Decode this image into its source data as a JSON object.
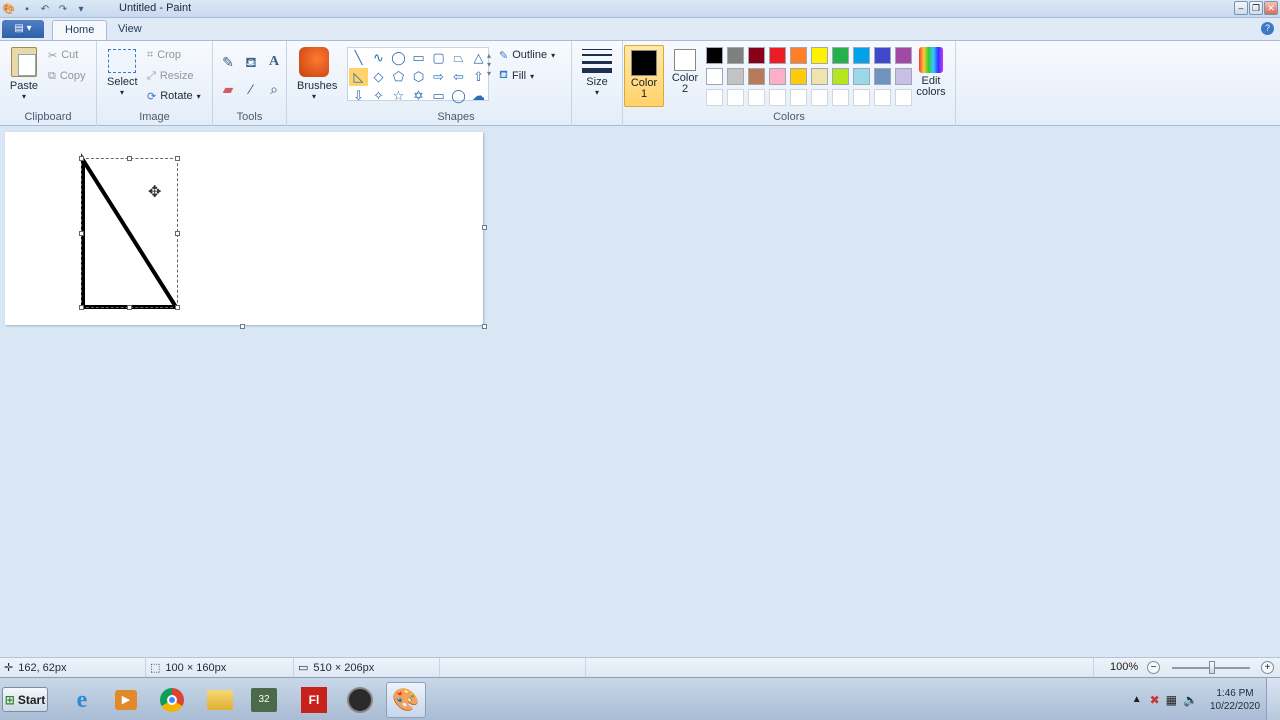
{
  "window": {
    "title": "Untitled - Paint"
  },
  "tabs": [
    {
      "label": "Home"
    },
    {
      "label": "View"
    }
  ],
  "ribbon": {
    "clipboard": {
      "label": "Clipboard",
      "paste": "Paste",
      "cut": "Cut",
      "copy": "Copy"
    },
    "image": {
      "label": "Image",
      "select": "Select",
      "crop": "Crop",
      "resize": "Resize",
      "rotate": "Rotate"
    },
    "tools": {
      "label": "Tools"
    },
    "brushes": {
      "label": "Brushes"
    },
    "shapes": {
      "label": "Shapes",
      "outline": "Outline",
      "fill": "Fill"
    },
    "size": {
      "label": "Size"
    },
    "colors": {
      "label": "Colors",
      "color1": "Color",
      "color1_num": "1",
      "color2": "Color",
      "color2_num": "2",
      "edit": "Edit",
      "edit2": "colors",
      "color1_value": "#000000",
      "color2_value": "#ffffff",
      "palette": [
        "#000000",
        "#7f7f7f",
        "#880015",
        "#ed1c24",
        "#ff7f27",
        "#fff200",
        "#22b14c",
        "#00a2e8",
        "#3f48cc",
        "#a349a4",
        "#ffffff",
        "#c3c3c3",
        "#b97a57",
        "#ffaec9",
        "#ffc90e",
        "#efe4b0",
        "#b5e61d",
        "#99d9ea",
        "#7092be",
        "#c8bfe7",
        "#ffffff",
        "#ffffff",
        "#ffffff",
        "#ffffff",
        "#ffffff",
        "#ffffff",
        "#ffffff",
        "#ffffff",
        "#ffffff",
        "#ffffff"
      ]
    }
  },
  "status": {
    "cursor_pos": "162, 62px",
    "selection_size": "100 × 160px",
    "image_size": "510 × 206px",
    "zoom": "100%"
  },
  "taskbar": {
    "start": "Start",
    "time": "1:46 PM",
    "date": "10/22/2020"
  }
}
